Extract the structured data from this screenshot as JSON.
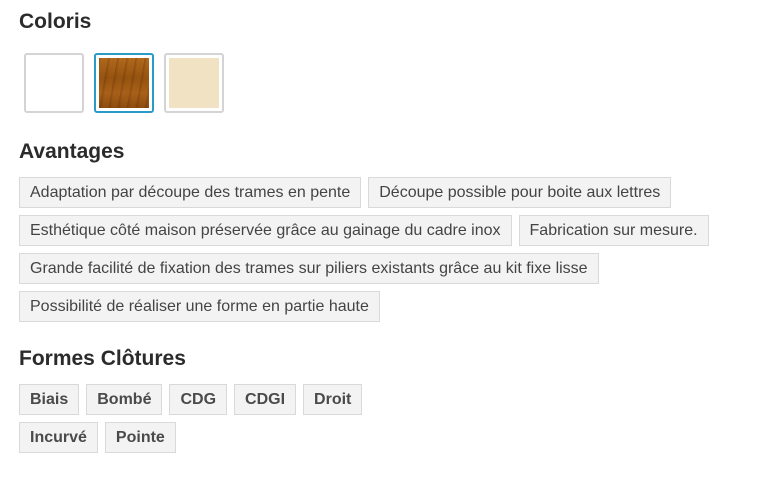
{
  "sections": {
    "coloris": {
      "title": "Coloris",
      "swatches": [
        {
          "name": "white",
          "color": "#ffffff",
          "selected": false
        },
        {
          "name": "wood",
          "color": "#a35e18",
          "selected": true
        },
        {
          "name": "cream",
          "color": "#f1e2c4",
          "selected": false
        }
      ]
    },
    "avantages": {
      "title": "Avantages",
      "tags": [
        "Adaptation par découpe des trames en pente",
        "Découpe possible pour boite aux lettres",
        "Esthétique côté maison préservée grâce au gainage du cadre inox",
        "Fabrication sur mesure.",
        "Grande facilité de fixation des trames sur piliers existants grâce au kit fixe lisse",
        "Possibilité de réaliser une forme en partie haute"
      ]
    },
    "formes": {
      "title": "Formes Clôtures",
      "tags": [
        "Biais",
        "Bombé",
        "CDG",
        "CDGI",
        "Droit",
        "Incurvé",
        "Pointe"
      ]
    }
  },
  "colors": {
    "selected_border": "#2a9bc6",
    "tag_background": "#f3f3f3",
    "tag_border": "#d9d9d9"
  }
}
